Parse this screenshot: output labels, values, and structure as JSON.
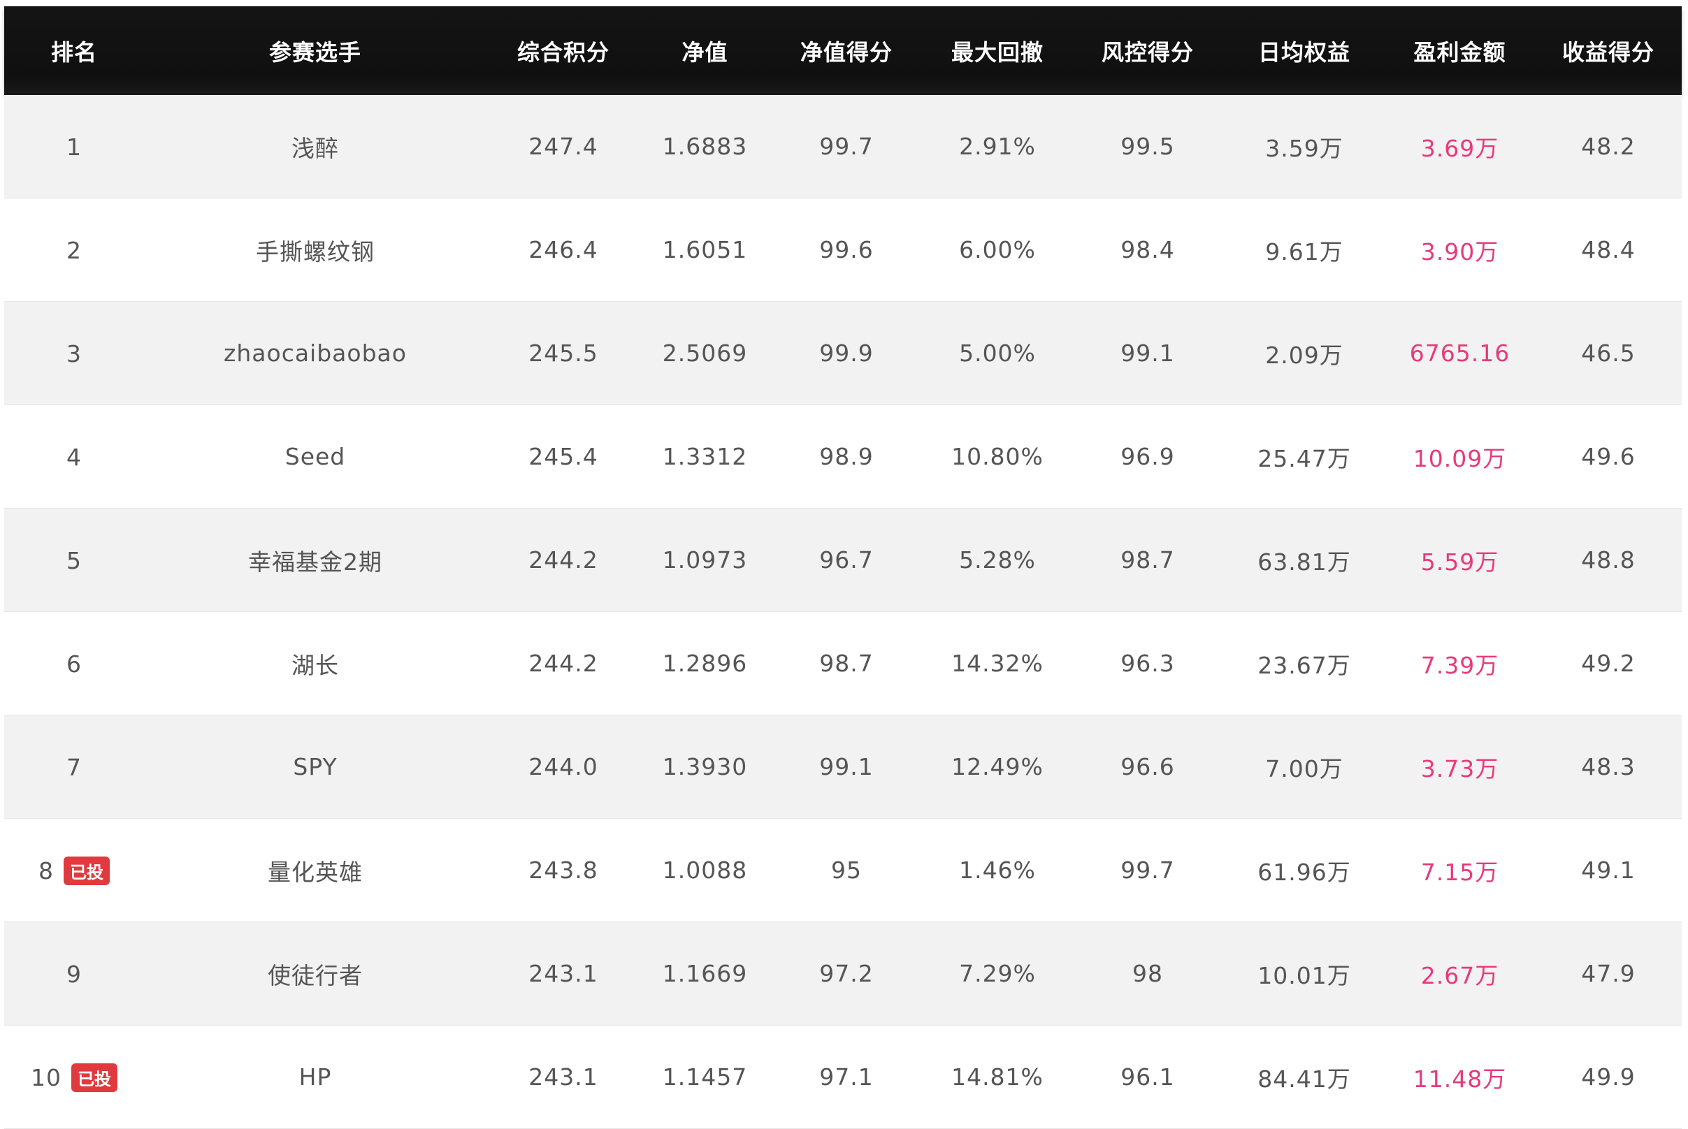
{
  "table": {
    "headers": [
      "排名",
      "参赛选手",
      "综合积分",
      "净值",
      "净值得分",
      "最大回撤",
      "风控得分",
      "日均权益",
      "盈利金额",
      "收益得分"
    ],
    "badge_label": "已投",
    "colors": {
      "header_bg": "#111111",
      "row_alt_bg": "#f2f2f2",
      "profit_text": "#e8397a",
      "badge_bg": "#e03a3e"
    },
    "rows": [
      {
        "rank": "1",
        "player": "浅醉",
        "score": "247.4",
        "nav": "1.6883",
        "nav_score": "99.7",
        "max_drawdown": "2.91%",
        "risk_score": "99.5",
        "daily_equity": "3.59万",
        "profit": "3.69万",
        "return_score": "48.2",
        "badge": ""
      },
      {
        "rank": "2",
        "player": "手撕螺纹钢",
        "score": "246.4",
        "nav": "1.6051",
        "nav_score": "99.6",
        "max_drawdown": "6.00%",
        "risk_score": "98.4",
        "daily_equity": "9.61万",
        "profit": "3.90万",
        "return_score": "48.4",
        "badge": ""
      },
      {
        "rank": "3",
        "player": "zhaocaibaobao",
        "score": "245.5",
        "nav": "2.5069",
        "nav_score": "99.9",
        "max_drawdown": "5.00%",
        "risk_score": "99.1",
        "daily_equity": "2.09万",
        "profit": "6765.16",
        "return_score": "46.5",
        "badge": ""
      },
      {
        "rank": "4",
        "player": "Seed",
        "score": "245.4",
        "nav": "1.3312",
        "nav_score": "98.9",
        "max_drawdown": "10.80%",
        "risk_score": "96.9",
        "daily_equity": "25.47万",
        "profit": "10.09万",
        "return_score": "49.6",
        "badge": ""
      },
      {
        "rank": "5",
        "player": "幸福基金2期",
        "score": "244.2",
        "nav": "1.0973",
        "nav_score": "96.7",
        "max_drawdown": "5.28%",
        "risk_score": "98.7",
        "daily_equity": "63.81万",
        "profit": "5.59万",
        "return_score": "48.8",
        "badge": ""
      },
      {
        "rank": "6",
        "player": "湖长",
        "score": "244.2",
        "nav": "1.2896",
        "nav_score": "98.7",
        "max_drawdown": "14.32%",
        "risk_score": "96.3",
        "daily_equity": "23.67万",
        "profit": "7.39万",
        "return_score": "49.2",
        "badge": ""
      },
      {
        "rank": "7",
        "player": "SPY",
        "score": "244.0",
        "nav": "1.3930",
        "nav_score": "99.1",
        "max_drawdown": "12.49%",
        "risk_score": "96.6",
        "daily_equity": "7.00万",
        "profit": "3.73万",
        "return_score": "48.3",
        "badge": ""
      },
      {
        "rank": "8",
        "player": "量化英雄",
        "score": "243.8",
        "nav": "1.0088",
        "nav_score": "95",
        "max_drawdown": "1.46%",
        "risk_score": "99.7",
        "daily_equity": "61.96万",
        "profit": "7.15万",
        "return_score": "49.1",
        "badge": "已投"
      },
      {
        "rank": "9",
        "player": "使徒行者",
        "score": "243.1",
        "nav": "1.1669",
        "nav_score": "97.2",
        "max_drawdown": "7.29%",
        "risk_score": "98",
        "daily_equity": "10.01万",
        "profit": "2.67万",
        "return_score": "47.9",
        "badge": ""
      },
      {
        "rank": "10",
        "player": "HP",
        "score": "243.1",
        "nav": "1.1457",
        "nav_score": "97.1",
        "max_drawdown": "14.81%",
        "risk_score": "96.1",
        "daily_equity": "84.41万",
        "profit": "11.48万",
        "return_score": "49.9",
        "badge": "已投"
      }
    ]
  }
}
